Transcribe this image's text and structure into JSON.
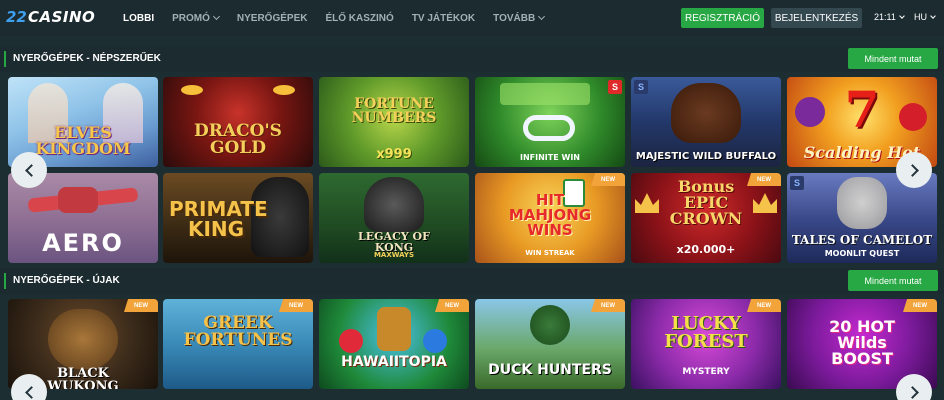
{
  "header": {
    "logo_prefix": "22",
    "logo_text": "CASINO",
    "nav": [
      {
        "label": "LOBBI",
        "active": true,
        "dropdown": false
      },
      {
        "label": "PROMÓ",
        "active": false,
        "dropdown": true
      },
      {
        "label": "NYERŐGÉPEK",
        "active": false,
        "dropdown": false
      },
      {
        "label": "ÉLŐ KASZINÓ",
        "active": false,
        "dropdown": false
      },
      {
        "label": "TV JÁTÉKOK",
        "active": false,
        "dropdown": false
      },
      {
        "label": "TOVÁBB",
        "active": false,
        "dropdown": true
      }
    ],
    "register_label": "REGISZTRÁCIÓ",
    "login_label": "BEJELENTKEZÉS",
    "time": "21:11",
    "language": "HU"
  },
  "colors": {
    "accent_green": "#27a844",
    "background": "#1d2e33",
    "new_badge": "#f2a33a"
  },
  "sections": [
    {
      "title": "NYERŐGÉPEK - NÉPSZERŰEK",
      "see_all_label": "Mindent mutat",
      "games": [
        {
          "title": "ELVES KINGDOM"
        },
        {
          "title": "DRACO'S GOLD"
        },
        {
          "title": "FORTUNE NUMBERS",
          "sub": "x999"
        },
        {
          "title": "",
          "sub": "INFINITE WIN"
        },
        {
          "title": "MAJESTIC WILD BUFFALO"
        },
        {
          "title": "Scalding Hot"
        },
        {
          "title": "AERO"
        },
        {
          "title": "PRIMATE KING"
        },
        {
          "title": "LEGACY OF KONG",
          "sub": "MAXWAYS"
        },
        {
          "title": "HIT MAHJONG WINS",
          "sub": "WIN STREAK",
          "badge": "NEW"
        },
        {
          "title": "Bonus EPIC CROWN",
          "sub": "x20.000+",
          "badge": "NEW"
        },
        {
          "title": "TALES OF CAMELOT",
          "sub": "MOONLIT QUEST"
        }
      ]
    },
    {
      "title": "NYERŐGÉPEK - ÚJAK",
      "see_all_label": "Mindent mutat",
      "games": [
        {
          "title": "BLACK WUKONG",
          "badge": "NEW"
        },
        {
          "title": "GREEK FORTUNES",
          "badge": "NEW"
        },
        {
          "title": "HAWAIITOPIA",
          "badge": "NEW"
        },
        {
          "title": "DUCK HUNTERS",
          "badge": "NEW"
        },
        {
          "title": "LUCKY FOREST",
          "sub": "MYSTERY",
          "badge": "NEW"
        },
        {
          "title": "20 HOT Wilds BOOST",
          "badge": "NEW"
        }
      ]
    }
  ]
}
